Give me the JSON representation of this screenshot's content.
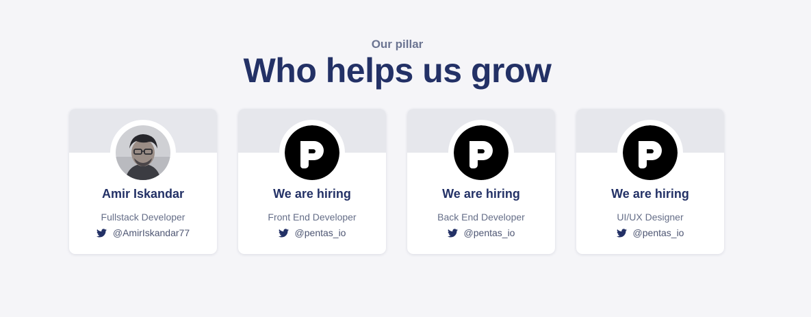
{
  "section": {
    "eyebrow": "Our pillar",
    "heading": "Who helps us grow"
  },
  "cards": [
    {
      "name": "Amir Iskandar",
      "role": "Fullstack Developer",
      "handle": "@AmirIskandar77",
      "avatar": "person-photo",
      "social_icon": "twitter-icon"
    },
    {
      "name": "We are hiring",
      "role": "Front End Developer",
      "handle": "@pentas_io",
      "avatar": "pentas-logo",
      "social_icon": "twitter-icon"
    },
    {
      "name": "We are hiring",
      "role": "Back End Developer",
      "handle": "@pentas_io",
      "avatar": "pentas-logo",
      "social_icon": "twitter-icon"
    },
    {
      "name": "We are hiring",
      "role": "UI/UX Designer",
      "handle": "@pentas_io",
      "avatar": "pentas-logo",
      "social_icon": "twitter-icon"
    }
  ],
  "colors": {
    "background": "#f5f5f8",
    "heading": "#233166",
    "eyebrow": "#6b7491",
    "banner": "#e6e7ec",
    "card": "#ffffff",
    "twitter_icon": "#233166"
  }
}
